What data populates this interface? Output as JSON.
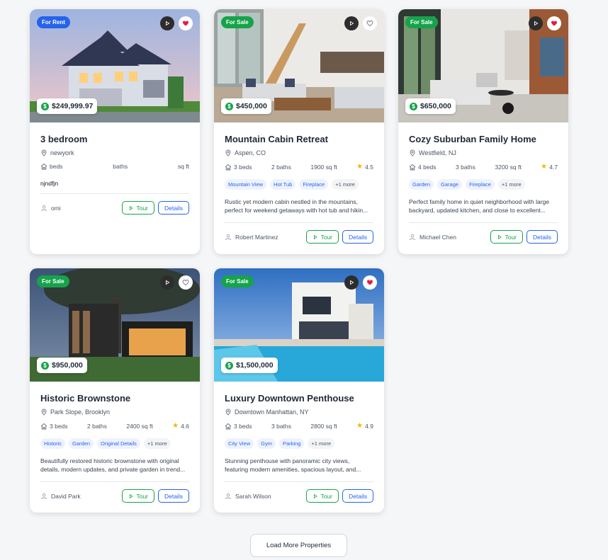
{
  "colors": {
    "rent_badge": "#2563eb",
    "sale_badge": "#16a34a",
    "tour": "#16a34a",
    "details": "#2563eb",
    "favorite": "#e11d48"
  },
  "icons": {
    "play": "play-icon",
    "favorite": "heart-icon",
    "location": "location-pin-icon",
    "beds": "home-icon",
    "rating": "star-icon",
    "agent": "user-icon",
    "price": "dollar-icon"
  },
  "properties": [
    {
      "badge": "For Rent",
      "favorited": true,
      "price": "$249,999.97",
      "title": "3 bedroom",
      "location": "newyork",
      "beds": "beds",
      "baths": "baths",
      "sqft": "sq ft",
      "rating": "",
      "tags": [],
      "more_tags": "",
      "description": "",
      "note": "njndfjn",
      "agent": "omi",
      "tour_label": "Tour",
      "details_label": "Details"
    },
    {
      "badge": "For Sale",
      "favorited": false,
      "price": "$450,000",
      "title": "Mountain Cabin Retreat",
      "location": "Aspen, CO",
      "beds": "3 beds",
      "baths": "2 baths",
      "sqft": "1900 sq ft",
      "rating": "4.5",
      "tags": [
        "Mountain View",
        "Hot Tub",
        "Fireplace"
      ],
      "more_tags": "+1 more",
      "description": "Rustic yet modern cabin nestled in the mountains, perfect for weekend getaways with hot tub and hikin...",
      "note": "",
      "agent": "Robert Martinez",
      "tour_label": "Tour",
      "details_label": "Details"
    },
    {
      "badge": "For Sale",
      "favorited": true,
      "price": "$650,000",
      "title": "Cozy Suburban Family Home",
      "location": "Westfield, NJ",
      "beds": "4 beds",
      "baths": "3 baths",
      "sqft": "3200 sq ft",
      "rating": "4.7",
      "tags": [
        "Garden",
        "Garage",
        "Fireplace"
      ],
      "more_tags": "+1 more",
      "description": "Perfect family home in quiet neighborhood with large backyard, updated kitchen, and close to excellent...",
      "note": "",
      "agent": "Michael Chen",
      "tour_label": "Tour",
      "details_label": "Details"
    },
    {
      "badge": "For Sale",
      "favorited": false,
      "price": "$950,000",
      "title": "Historic Brownstone",
      "location": "Park Slope, Brooklyn",
      "beds": "3 beds",
      "baths": "2 baths",
      "sqft": "2400 sq ft",
      "rating": "4.6",
      "tags": [
        "Historic",
        "Garden",
        "Original Details"
      ],
      "more_tags": "+1 more",
      "description": "Beautifully restored historic brownstone with original details, modern updates, and private garden in trend...",
      "note": "",
      "agent": "David Park",
      "tour_label": "Tour",
      "details_label": "Details"
    },
    {
      "badge": "For Sale",
      "favorited": true,
      "price": "$1,500,000",
      "title": "Luxury Downtown Penthouse",
      "location": "Downtown Manhattan, NY",
      "beds": "3 beds",
      "baths": "3 baths",
      "sqft": "2800 sq ft",
      "rating": "4.9",
      "tags": [
        "City View",
        "Gym",
        "Parking"
      ],
      "more_tags": "+1 more",
      "description": "Stunning penthouse with panoramic city views, featuring modern amenities, spacious layout, and...",
      "note": "",
      "agent": "Sarah Wilson",
      "tour_label": "Tour",
      "details_label": "Details"
    }
  ],
  "load_more_label": "Load More Properties"
}
